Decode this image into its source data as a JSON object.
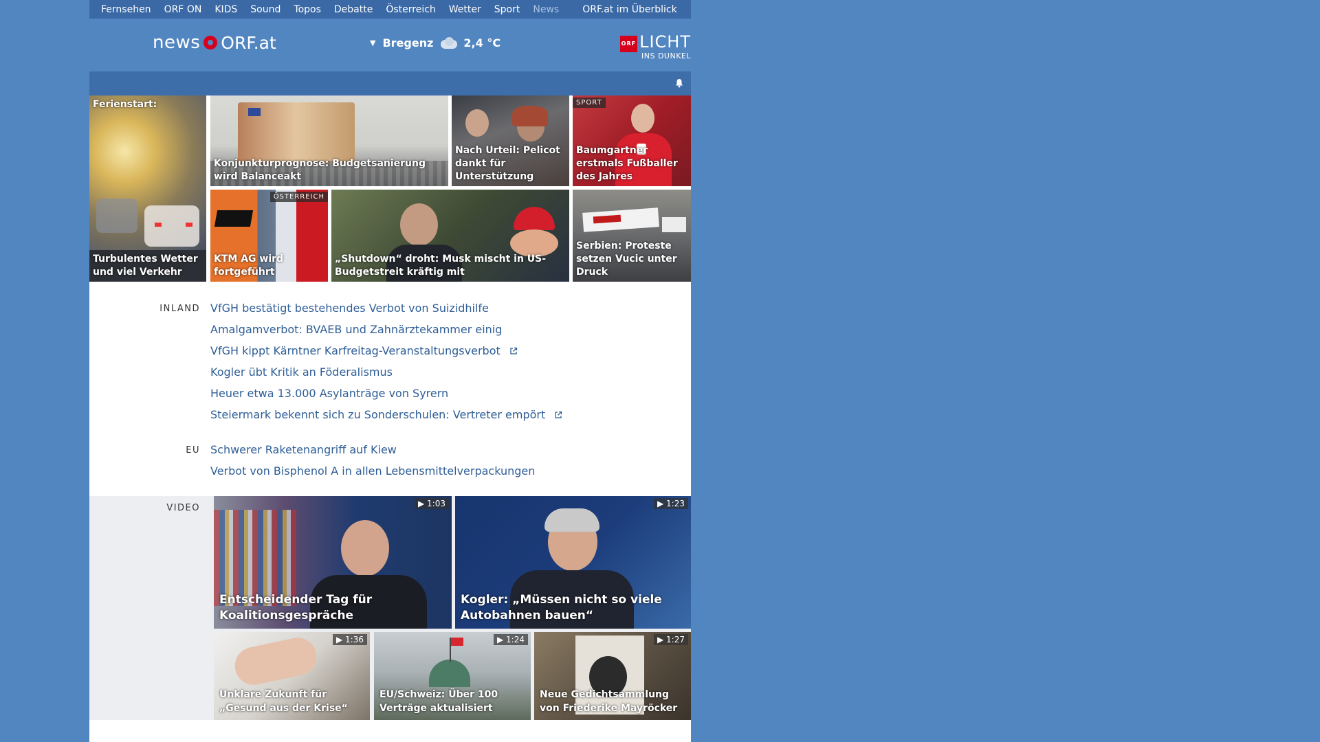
{
  "topnav": [
    "Fernsehen",
    "ORF ON",
    "KIDS",
    "Sound",
    "Topos",
    "Debatte",
    "Österreich",
    "Wetter",
    "Sport",
    "News"
  ],
  "topnav_active": "News",
  "topnav_overview": "ORF.at im Überblick",
  "logo": {
    "news": "news",
    "orf": "ORF.at"
  },
  "weather": {
    "city": "Bregenz",
    "temp": "2,4 °C",
    "icon": "cloud-icon"
  },
  "licht": {
    "badge": "ORF",
    "line1": "LICHT",
    "line2": "INS DUNKEL"
  },
  "tiles": {
    "t1": {
      "label": "Ferienstart:",
      "caption": "Turbulentes Wetter und viel Verkehr"
    },
    "t2": {
      "caption": "Konjunkturprognose: Budgetsanierung wird Balanceakt"
    },
    "t3": {
      "caption": "Nach Urteil: Pelicot dankt für Unterstützung"
    },
    "t4": {
      "tag": "SPORT",
      "caption": "Baumgartner erstmals Fußballer des Jahres"
    },
    "t5": {
      "tag": "ÖSTERREICH",
      "caption": "KTM AG wird fortgeführt"
    },
    "t6": {
      "caption": "„Shutdown“ droht: Musk mischt in US-Budgetstreit kräftig mit"
    },
    "t7": {
      "caption": "Serbien: Proteste setzen Vucic unter Druck"
    }
  },
  "inland": {
    "label": "INLAND",
    "items": [
      "VfGH bestätigt bestehendes Verbot von Suizidhilfe",
      "Amalgamverbot: BVAEB und Zahnärztekammer einig",
      "VfGH kippt Kärntner Karfreitag-Veranstaltungsverbot",
      "Kogler übt Kritik an Föderalismus",
      "Heuer etwa 13.000 Asylanträge von Syrern",
      "Steiermark bekennt sich zu Sonderschulen: Vertreter empört"
    ]
  },
  "eu": {
    "label": "EU",
    "items": [
      "Schwerer Raketenangriff auf Kiew",
      "Verbot von Bisphenol A in allen Lebensmittelverpackungen"
    ]
  },
  "video": {
    "label": "VIDEO",
    "items": [
      {
        "duration": "1:03",
        "caption": "Entscheidender Tag für Koalitionsgespräche"
      },
      {
        "duration": "1:23",
        "caption": "Kogler: „Müssen nicht so viele Autobahnen bauen“"
      },
      {
        "duration": "1:36",
        "caption": "Unklare Zukunft für „Gesund aus der Krise“"
      },
      {
        "duration": "1:24",
        "caption": "EU/Schweiz: Über 100 Verträge aktualisiert"
      },
      {
        "duration": "1:27",
        "caption": "Neue Gedichtsammlung von Friederike Mayröcker"
      }
    ]
  },
  "colors": {
    "page_bg": "#5286c1",
    "nav_bg": "#3a69a6",
    "link": "#2e5e97",
    "accent": "#d6001c"
  }
}
